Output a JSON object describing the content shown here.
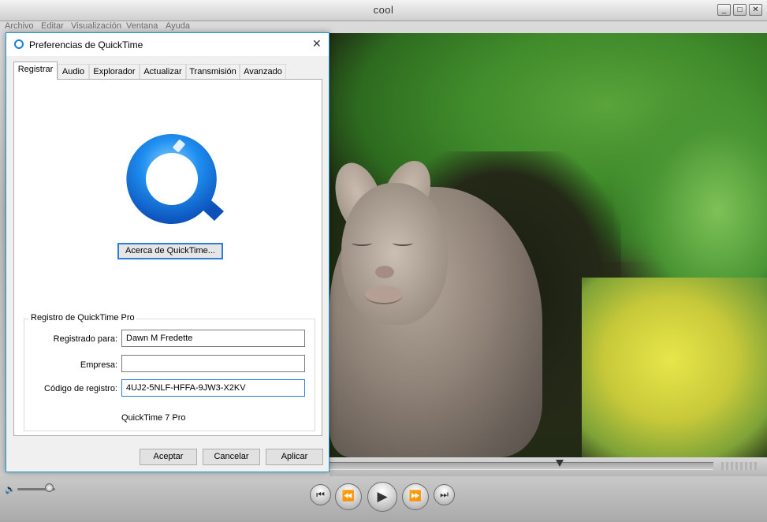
{
  "player": {
    "title": "cool",
    "window_buttons": {
      "minimize": "_",
      "maximize": "□",
      "close": "✕"
    },
    "menu": [
      "Archivo",
      "Editar",
      "Visualización",
      "Ventana",
      "Ayuda"
    ],
    "controls": {
      "speaker_icon": "🔈",
      "skip_start": "⏮",
      "rewind": "⏪",
      "play": "▶",
      "fast_forward": "⏩",
      "skip_end": "⏭"
    },
    "volume_level": 0.85,
    "playhead_position": 0.6
  },
  "dialog": {
    "title": "Preferencias de QuickTime",
    "close_glyph": "✕",
    "tabs": [
      "Registrar",
      "Audio",
      "Explorador",
      "Actualizar",
      "Transmisión",
      "Avanzado"
    ],
    "active_tab": "Registrar",
    "about_button": "Acerca de QuickTime...",
    "registration_group": {
      "label": "Registro de QuickTime Pro",
      "registered_to_label": "Registrado para:",
      "registered_to_value": "Dawn M Fredette",
      "company_label": "Empresa:",
      "company_value": "",
      "code_label": "Código de registro:",
      "code_value": "4UJ2-5NLF-HFFA-9JW3-X2KV",
      "version": "QuickTime 7 Pro"
    },
    "buttons": {
      "ok": "Aceptar",
      "cancel": "Cancelar",
      "apply": "Aplicar"
    }
  },
  "colors": {
    "accent_blue": "#1b9bd0",
    "focus_blue": "#2f7bd8",
    "quicktime_blue": "#1a7fd6"
  }
}
